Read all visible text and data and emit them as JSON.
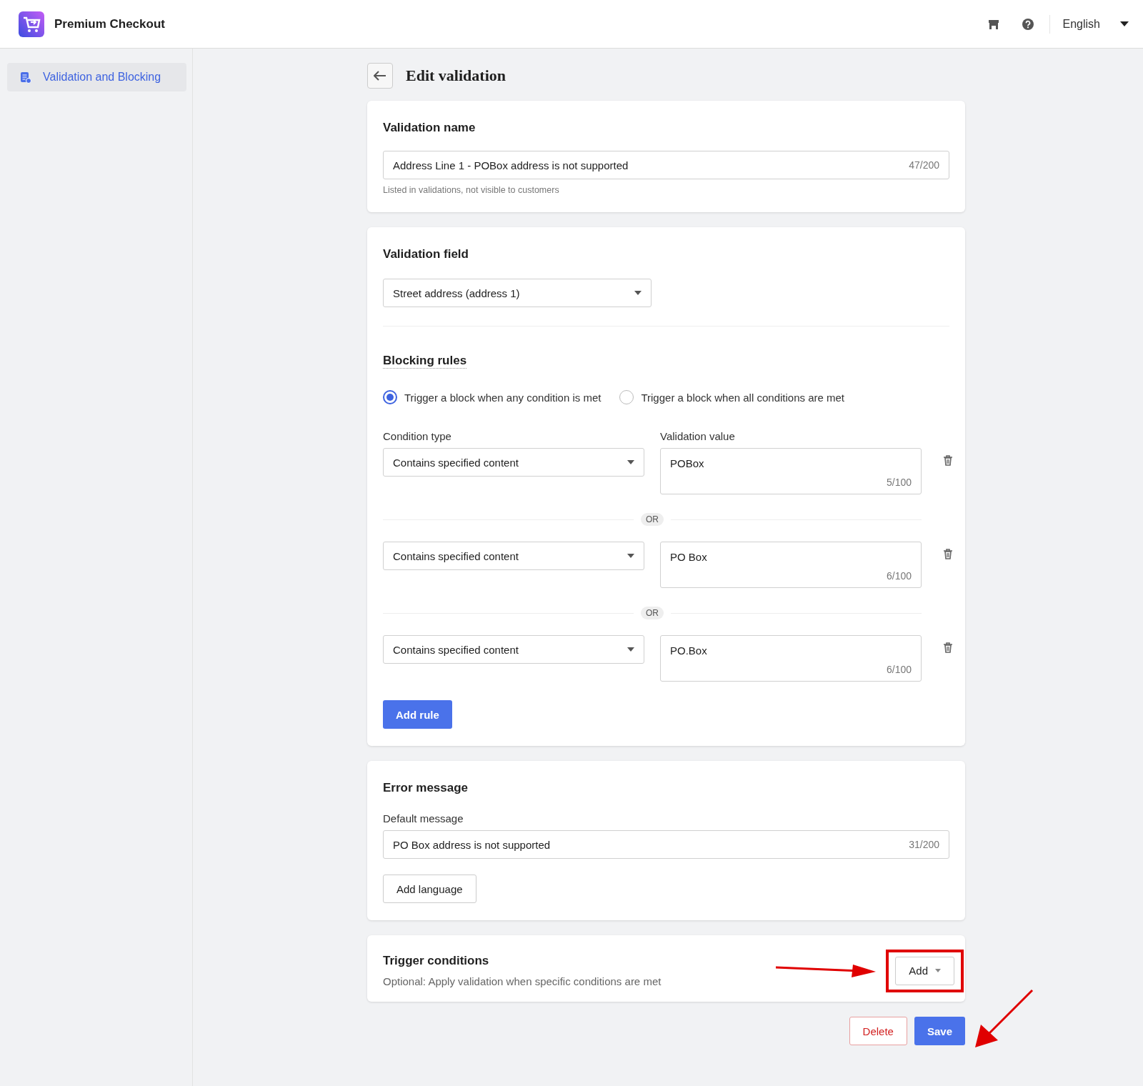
{
  "header": {
    "app_name": "Premium Checkout",
    "language": "English"
  },
  "sidebar": {
    "items": [
      {
        "label": "Validation and Blocking",
        "selected": true
      }
    ]
  },
  "page": {
    "title": "Edit validation"
  },
  "validation_name": {
    "title": "Validation name",
    "value": "Address Line 1 - POBox address is not supported",
    "counter": "47/200",
    "hint": "Listed in validations, not visible to customers"
  },
  "validation_field": {
    "title": "Validation field",
    "value": "Street address (address 1)"
  },
  "blocking_rules": {
    "title": "Blocking rules",
    "modes": [
      {
        "label": "Trigger a block when any condition is met",
        "selected": true
      },
      {
        "label": "Trigger a block when all conditions are met",
        "selected": false
      }
    ],
    "condition_type_label": "Condition type",
    "validation_value_label": "Validation value",
    "rules": [
      {
        "condition": "Contains specified content",
        "value": "POBox",
        "counter": "5/100"
      },
      {
        "separator": "OR",
        "condition": "Contains specified content",
        "value": "PO Box",
        "counter": "6/100"
      },
      {
        "separator": "OR",
        "condition": "Contains specified content",
        "value": "PO.Box",
        "counter": "6/100"
      }
    ],
    "add_button": "Add rule"
  },
  "error_message": {
    "title": "Error message",
    "label": "Default message",
    "value": "PO Box address is not supported",
    "counter": "31/200",
    "add_button": "Add language"
  },
  "trigger_conditions": {
    "title": "Trigger conditions",
    "description": "Optional: Apply validation when specific conditions are met",
    "add_button": "Add",
    "highlighted": true
  },
  "actions": {
    "delete": "Delete",
    "save": "Save"
  }
}
